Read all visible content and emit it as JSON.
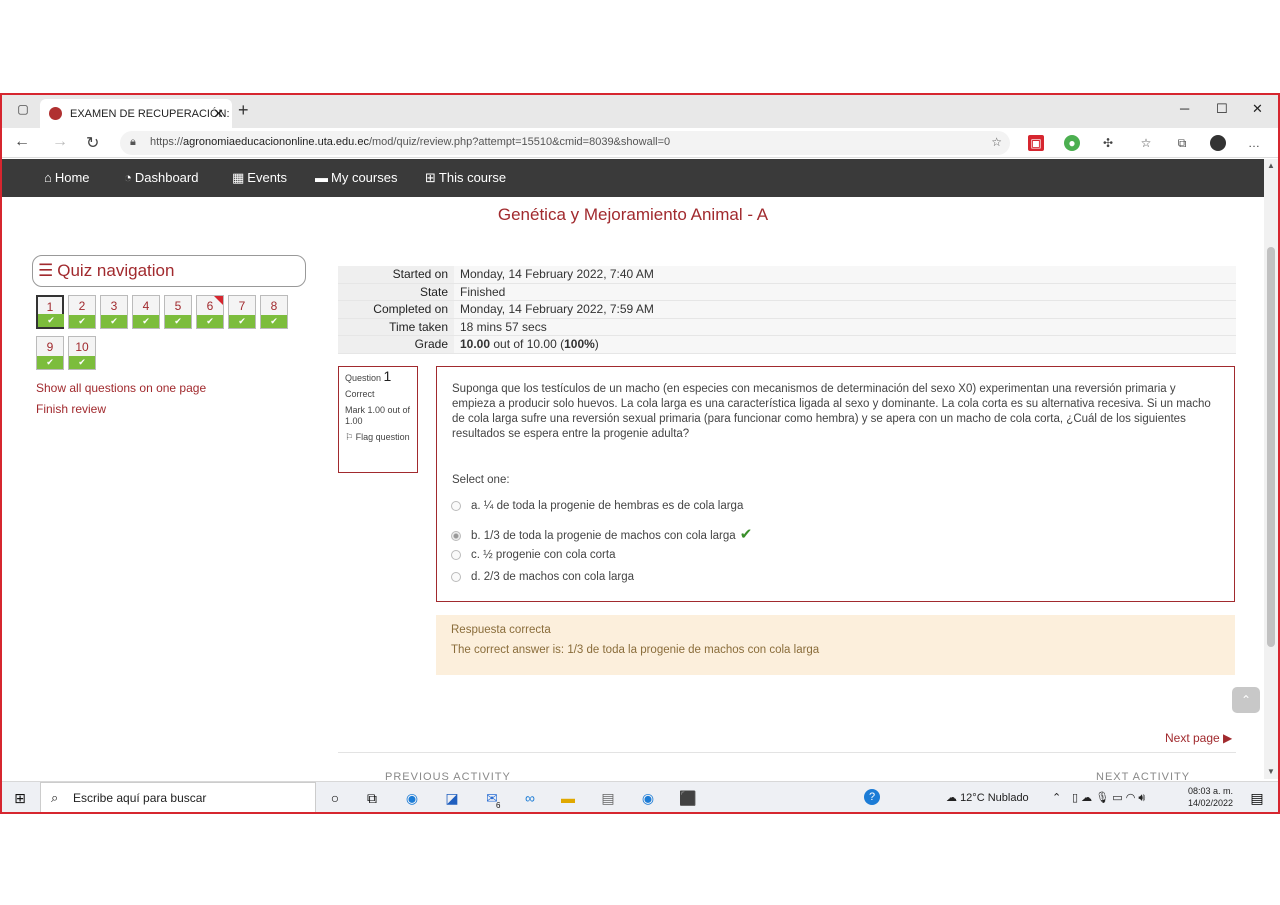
{
  "browser": {
    "tab_title": "EXAMEN DE RECUPERACIÓN: At",
    "url_prefix": "https://",
    "url_host": "agronomiaeducaciononline.uta.edu.ec",
    "url_path": "/mod/quiz/review.php?attempt=15510&cmid=8039&showall=0"
  },
  "sitenav": {
    "home": "Home",
    "dashboard": "Dashboard",
    "events": "Events",
    "my_courses": "My courses",
    "this_course": "This course"
  },
  "course_title": "Genética y Mejoramiento Animal - A",
  "quiz_nav": {
    "title": "Quiz navigation",
    "buttons": [
      "1",
      "2",
      "3",
      "4",
      "5",
      "6",
      "7",
      "8",
      "9",
      "10"
    ],
    "show_all": "Show all questions on one page",
    "finish": "Finish review"
  },
  "summary": {
    "started_label": "Started on",
    "started_value": "Monday, 14 February 2022, 7:40 AM",
    "state_label": "State",
    "state_value": "Finished",
    "completed_label": "Completed on",
    "completed_value": "Monday, 14 February 2022, 7:59 AM",
    "time_label": "Time taken",
    "time_value": "18 mins 57 secs",
    "grade_label": "Grade",
    "grade_score": "10.00",
    "grade_mid": " out of 10.00 (",
    "grade_pct": "100%",
    "grade_end": ")"
  },
  "question": {
    "label": "Question",
    "number": "1",
    "status": "Correct",
    "mark": "Mark 1.00 out of 1.00",
    "flag": "Flag question",
    "text": "Suponga que los testículos de un macho (en especies con mecanismos de determinación del sexo X0) experimentan una reversión primaria y empieza a producir solo huevos. La cola larga es una característica ligada al sexo y dominante. La cola corta es su alternativa recesiva. Si un macho de cola larga sufre una reversión sexual primaria (para funcionar como hembra) y se apera con un macho de cola corta, ¿Cuál de los siguientes resultados se espera entre la progenie adulta?",
    "select_one": "Select one:",
    "options": [
      "a.  ¼ de toda la progenie de hembras es de cola larga",
      "b. 1/3 de toda la progenie de machos con cola larga",
      "c. ½ progenie con cola corta",
      "d. 2/3 de machos con cola larga"
    ]
  },
  "feedback": {
    "general": "Respuesta correcta",
    "correct_answer": "The correct answer is: 1/3 de toda la progenie de machos con cola larga"
  },
  "next_page": "Next page ▶",
  "previous_activity": "PREVIOUS ACTIVITY",
  "next_activity": "NEXT ACTIVITY",
  "taskbar": {
    "search_placeholder": "Escribe aquí para buscar",
    "mail_badge": "6",
    "weather": "12°C  Nublado",
    "time": "08:03 a. m.",
    "date": "14/02/2022"
  },
  "colors": {
    "brand": "#a12a2e",
    "navbar": "#3a3a3a",
    "correct": "#7cbd3c",
    "feedback_bg": "#fcefdc"
  }
}
